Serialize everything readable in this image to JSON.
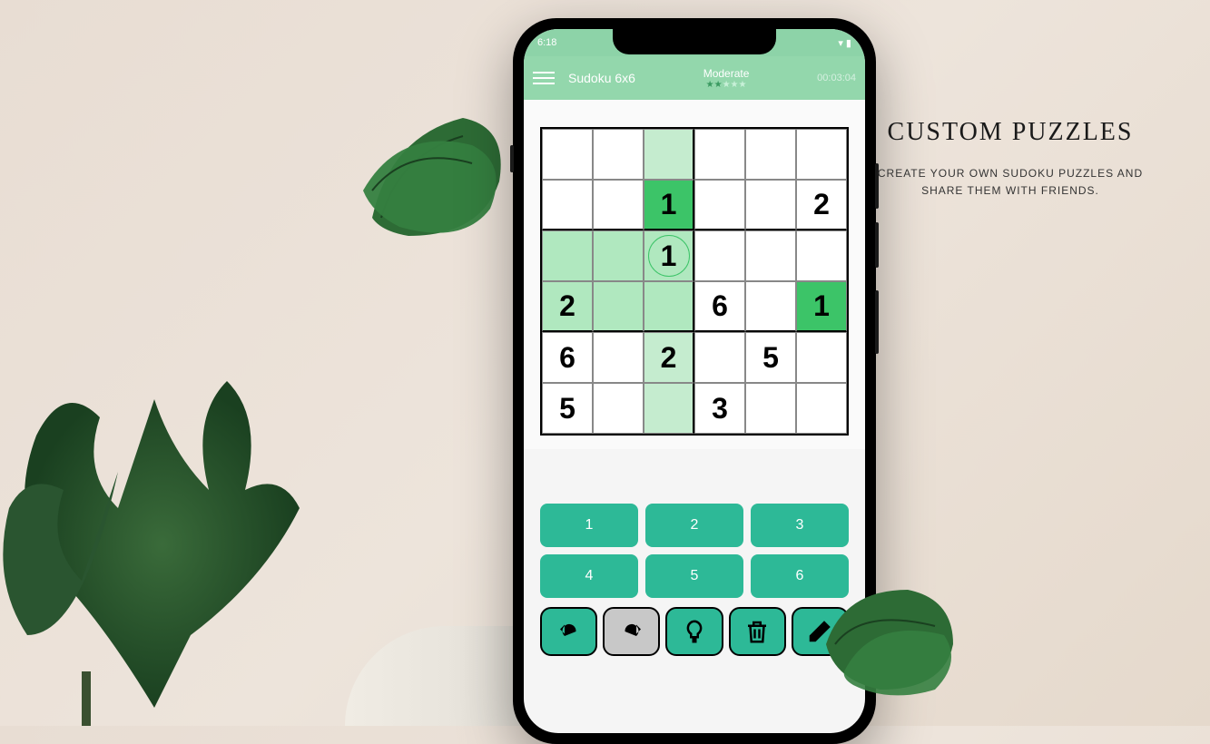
{
  "marketing": {
    "title": "CUSTOM PUZZLES",
    "description": "CREATE YOUR OWN SUDOKU PUZZLES AND SHARE THEM WITH FRIENDS."
  },
  "status": {
    "time": "6:18"
  },
  "header": {
    "title": "Sudoku 6x6",
    "difficulty": "Moderate",
    "stars_filled": 2,
    "stars_total": 5,
    "timer": "00:03:04"
  },
  "grid": {
    "size": 6,
    "selected": [
      1,
      2
    ],
    "highlighted_column": 2,
    "highlighted_box_cells": [
      [
        2,
        0
      ],
      [
        2,
        1
      ],
      [
        2,
        2
      ],
      [
        3,
        0
      ],
      [
        3,
        1
      ],
      [
        3,
        2
      ]
    ],
    "cells": [
      [
        "",
        "",
        "",
        "",
        "",
        ""
      ],
      [
        "",
        "",
        "1",
        "",
        "",
        "2"
      ],
      [
        "",
        "",
        "1",
        "",
        "",
        ""
      ],
      [
        "2",
        "",
        "",
        "6",
        "",
        "1"
      ],
      [
        "6",
        "",
        "2",
        "",
        "5",
        ""
      ],
      [
        "5",
        "",
        "",
        "3",
        "",
        ""
      ]
    ],
    "same_value_highlight": [
      [
        3,
        5
      ]
    ],
    "same_value_circle": [
      [
        2,
        2
      ]
    ]
  },
  "numpad": [
    "1",
    "2",
    "3",
    "4",
    "5",
    "6"
  ],
  "actions": [
    {
      "name": "undo",
      "disabled": false
    },
    {
      "name": "redo",
      "disabled": true
    },
    {
      "name": "hint",
      "disabled": false
    },
    {
      "name": "delete",
      "disabled": false
    },
    {
      "name": "pencil",
      "disabled": false
    }
  ]
}
